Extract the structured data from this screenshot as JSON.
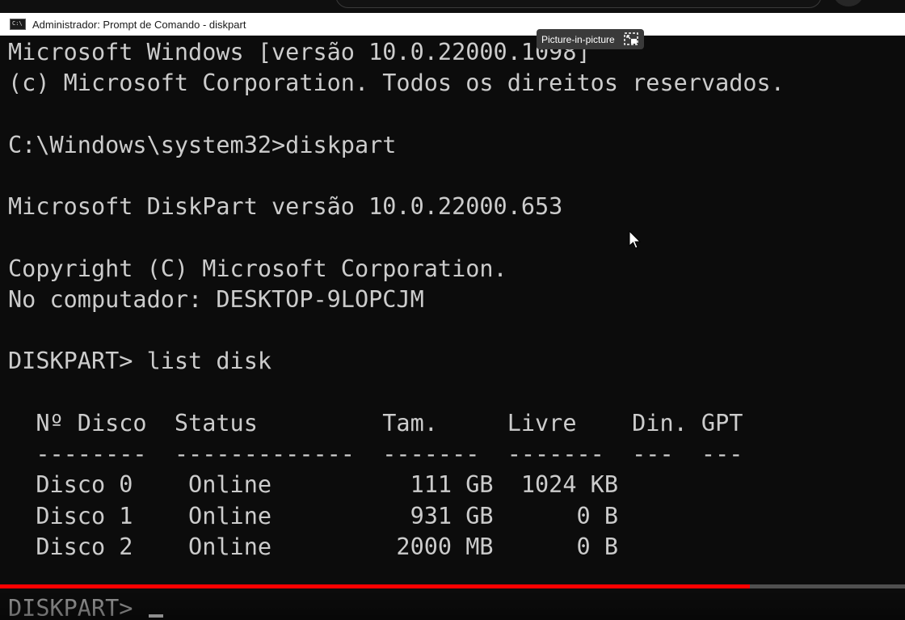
{
  "window": {
    "title": "Administrador: Prompt de Comando - diskpart"
  },
  "console": {
    "lines": [
      "Microsoft Windows [versão 10.0.22000.1098]",
      "(c) Microsoft Corporation. Todos os direitos reservados.",
      "",
      "C:\\Windows\\system32>diskpart",
      "",
      "Microsoft DiskPart versão 10.0.22000.653",
      "",
      "Copyright (C) Microsoft Corporation.",
      "No computador: DESKTOP-9LOPCJM",
      "",
      "DISKPART> list disk",
      "",
      "  Nº Disco  Status         Tam.     Livre    Din. GPT",
      "  --------  -------------  -------  -------  ---  ---",
      "  Disco 0    Online          111 GB  1024 KB",
      "  Disco 1    Online          931 GB      0 B",
      "  Disco 2    Online         2000 MB      0 B",
      "",
      "DISKPART> "
    ]
  },
  "tooltip": {
    "label": "Picture-in-picture",
    "icon": "picture-in-picture-icon"
  },
  "video": {
    "progress_fraction": 0.829
  },
  "colors": {
    "console_bg": "#0c0c0c",
    "console_text": "#cccccc",
    "titlebar_bg": "#ffffff",
    "progress": "#ff0000"
  }
}
